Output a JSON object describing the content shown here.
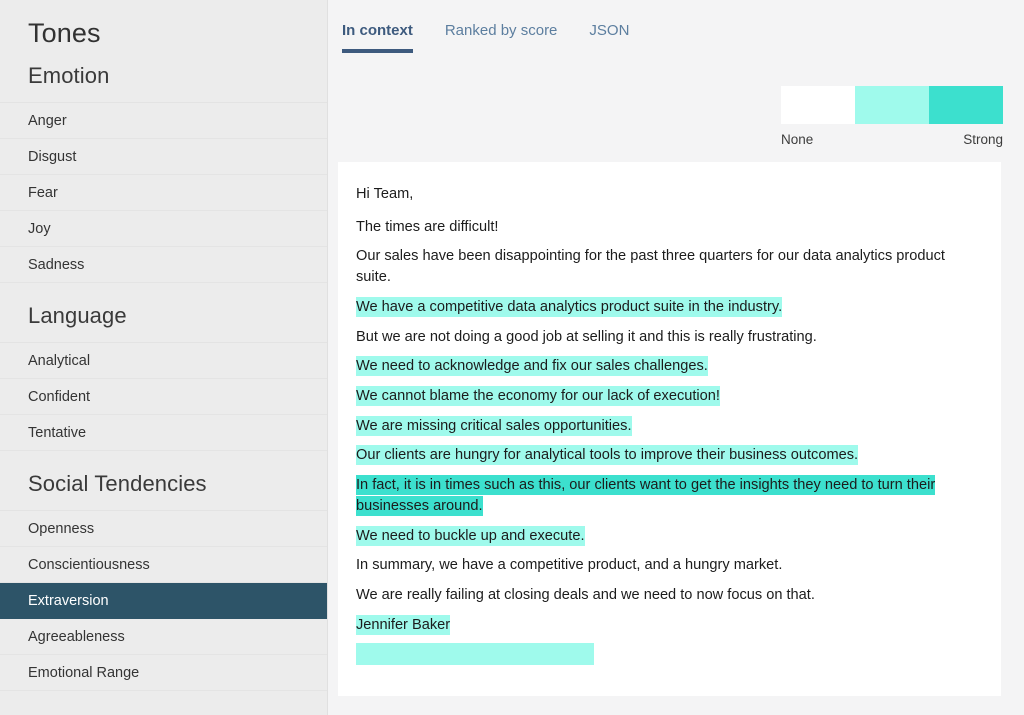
{
  "sidebar": {
    "title": "Tones",
    "groups": [
      {
        "header": "Emotion",
        "items": [
          {
            "label": "Anger",
            "selected": false
          },
          {
            "label": "Disgust",
            "selected": false
          },
          {
            "label": "Fear",
            "selected": false
          },
          {
            "label": "Joy",
            "selected": false
          },
          {
            "label": "Sadness",
            "selected": false
          }
        ]
      },
      {
        "header": "Language",
        "items": [
          {
            "label": "Analytical",
            "selected": false
          },
          {
            "label": "Confident",
            "selected": false
          },
          {
            "label": "Tentative",
            "selected": false
          }
        ]
      },
      {
        "header": "Social Tendencies",
        "items": [
          {
            "label": "Openness",
            "selected": false
          },
          {
            "label": "Conscientiousness",
            "selected": false
          },
          {
            "label": "Extraversion",
            "selected": true
          },
          {
            "label": "Agreeableness",
            "selected": false
          },
          {
            "label": "Emotional Range",
            "selected": false
          }
        ]
      }
    ]
  },
  "tabs": [
    {
      "label": "In context",
      "active": true
    },
    {
      "label": "Ranked by score",
      "active": false
    },
    {
      "label": "JSON",
      "active": false
    }
  ],
  "legend": {
    "segments": [
      "#ffffff",
      "#9ffaec",
      "#3ce0ce"
    ],
    "min_label": "None",
    "max_label": "Strong"
  },
  "colors": {
    "sidebar_bg": "#ececec",
    "sidebar_selected_bg": "#2d5468",
    "tab_active": "#3d5a7e",
    "tab_inactive": "#5c7e9f",
    "highlight_weak": "#9ffaec",
    "highlight_strong": "#3ce0ce",
    "page_bg": "#f4f4f5",
    "card_bg": "#ffffff"
  },
  "document": {
    "paragraphs": [
      {
        "text": "Hi Team,",
        "highlight": "none",
        "indent": true,
        "spaced": true
      },
      {
        "text": "The times are difficult!",
        "highlight": "none",
        "indent": false,
        "spaced": false
      },
      {
        "text": "Our sales have been disappointing for the past three quarters for our data analytics product suite.",
        "highlight": "none",
        "indent": true,
        "spaced": false
      },
      {
        "text": "We have a competitive data analytics product suite in the industry.",
        "highlight": "weak",
        "indent": false,
        "spaced": false
      },
      {
        "text": "But we are not doing a good job at selling it and this is really frustrating.",
        "highlight": "none",
        "indent": true,
        "spaced": false
      },
      {
        "text": "We need to acknowledge and fix our sales challenges.",
        "highlight": "weak",
        "indent": false,
        "spaced": false
      },
      {
        "text": "We cannot blame the economy for our lack of execution!",
        "highlight": "weak",
        "indent": false,
        "spaced": false
      },
      {
        "text": "We are missing critical sales opportunities.",
        "highlight": "weak",
        "indent": false,
        "spaced": false
      },
      {
        "text": "Our clients are hungry for analytical tools to improve their business outcomes.",
        "highlight": "weak",
        "indent": false,
        "spaced": false
      },
      {
        "text": "In fact, it is in times such as this, our clients want to get the insights they need to turn their businesses around.",
        "highlight": "strong",
        "indent": true,
        "spaced": false
      },
      {
        "text": "We need to buckle up and execute.",
        "highlight": "weak",
        "indent": false,
        "spaced": false
      },
      {
        "text": "In summary, we have a competitive product, and a hungry market.",
        "highlight": "none",
        "indent": false,
        "spaced": false
      },
      {
        "text": "We are really failing at closing deals and we need to now focus on that.",
        "highlight": "none",
        "indent": false,
        "spaced": false
      },
      {
        "text": "Jennifer Baker",
        "highlight": "weak",
        "indent": false,
        "spaced": false
      }
    ]
  }
}
